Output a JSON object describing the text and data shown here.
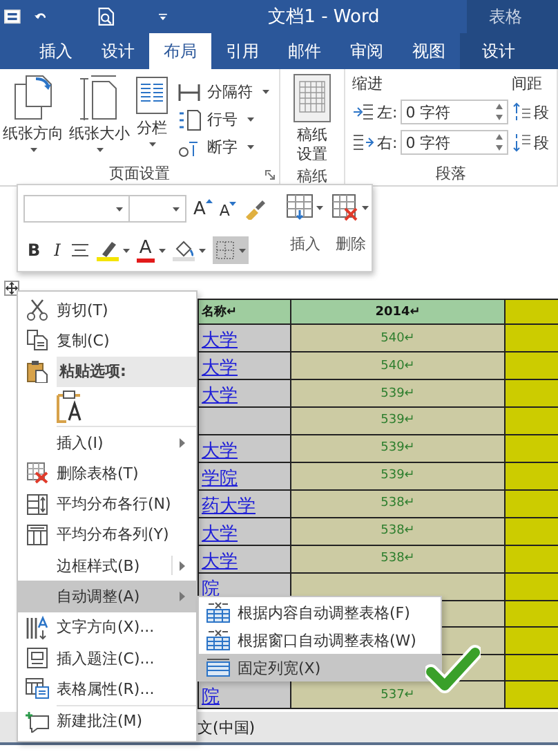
{
  "window": {
    "title": "文档1 - Word",
    "context_title": "表格"
  },
  "tabs": [
    {
      "label": "插入",
      "selected": false,
      "kind": "normal"
    },
    {
      "label": "设计",
      "selected": false,
      "kind": "normal"
    },
    {
      "label": "布局",
      "selected": true,
      "kind": "normal"
    },
    {
      "label": "引用",
      "selected": false,
      "kind": "normal"
    },
    {
      "label": "邮件",
      "selected": false,
      "kind": "normal"
    },
    {
      "label": "审阅",
      "selected": false,
      "kind": "normal"
    },
    {
      "label": "视图",
      "selected": false,
      "kind": "normal"
    },
    {
      "label": "设计",
      "selected": false,
      "kind": "context"
    }
  ],
  "ribbon": {
    "page_setup": {
      "label": "页面设置",
      "large_buttons": [
        {
          "label": "纸张方向"
        },
        {
          "label": "纸张大小"
        },
        {
          "label": "分栏"
        }
      ],
      "small_buttons": [
        {
          "label": "分隔符"
        },
        {
          "label": "行号"
        },
        {
          "label": "断字"
        }
      ]
    },
    "manuscript": {
      "label": "稿纸",
      "button": "稿纸设置"
    },
    "paragraph": {
      "label": "段落",
      "indent": {
        "label": "缩进",
        "fields": [
          {
            "label": "左:",
            "value": "0 字符"
          },
          {
            "label": "右:",
            "value": "0 字符"
          }
        ]
      },
      "spacing": {
        "label": "间距",
        "fields": [
          {
            "label": "段"
          },
          {
            "label": "段"
          }
        ]
      }
    }
  },
  "mini_toolbar": {
    "grow": "A",
    "shrink": "A",
    "bold": "B",
    "italic": "I",
    "font_color": "A",
    "borders": {
      "selected": true
    },
    "insert": "插入",
    "delete": "删除"
  },
  "context_menu": [
    {
      "kind": "item",
      "label": "剪切(T)",
      "submenu": false,
      "selected": false
    },
    {
      "kind": "item",
      "label": "复制(C)",
      "submenu": false,
      "selected": false
    },
    {
      "kind": "header",
      "label": "粘贴选项:"
    },
    {
      "kind": "paste-option"
    },
    {
      "kind": "item",
      "label": "插入(I)",
      "submenu": true,
      "selected": false,
      "separator_before": true
    },
    {
      "kind": "item",
      "label": "删除表格(T)",
      "submenu": false,
      "selected": false
    },
    {
      "kind": "item",
      "label": "平均分布各行(N)",
      "submenu": false,
      "selected": false
    },
    {
      "kind": "item",
      "label": "平均分布各列(Y)",
      "submenu": false,
      "selected": false
    },
    {
      "kind": "item",
      "label": "边框样式(B)",
      "submenu": true,
      "split": true,
      "selected": false
    },
    {
      "kind": "item",
      "label": "自动调整(A)",
      "submenu": true,
      "selected": true
    },
    {
      "kind": "item",
      "label": "文字方向(X)...",
      "submenu": false,
      "selected": false
    },
    {
      "kind": "item",
      "label": "插入题注(C)...",
      "submenu": false,
      "selected": false
    },
    {
      "kind": "item",
      "label": "表格属性(R)...",
      "submenu": false,
      "selected": false
    },
    {
      "kind": "item",
      "label": "新建批注(M)",
      "submenu": false,
      "selected": false,
      "separator_before": true
    }
  ],
  "submenu": [
    {
      "label": "根据内容自动调整表格(F)",
      "selected": false
    },
    {
      "label": "根据窗口自动调整表格(W)",
      "selected": false
    },
    {
      "label": "固定列宽(X)",
      "selected": true
    }
  ],
  "table": {
    "header": [
      "名称↵",
      "2014↵"
    ],
    "rows": [
      {
        "name": "大学",
        "score": "540↵"
      },
      {
        "name": "大学",
        "score": "540↵"
      },
      {
        "name": "大学",
        "score": "539↵"
      },
      {
        "score": "539↵"
      },
      {
        "name": "大学",
        "score": "539↵"
      },
      {
        "name": "学院",
        "score": "539↵"
      },
      {
        "name": "药大学",
        "score": "538↵"
      },
      {
        "name": "大学",
        "score": "538↵"
      },
      {
        "name": "大学",
        "score": "538↵"
      },
      {
        "name": "院"
      },
      {},
      {},
      {},
      {
        "name": "院",
        "score": "537↵"
      }
    ]
  },
  "status_bar": {
    "language": "文(中国)"
  }
}
